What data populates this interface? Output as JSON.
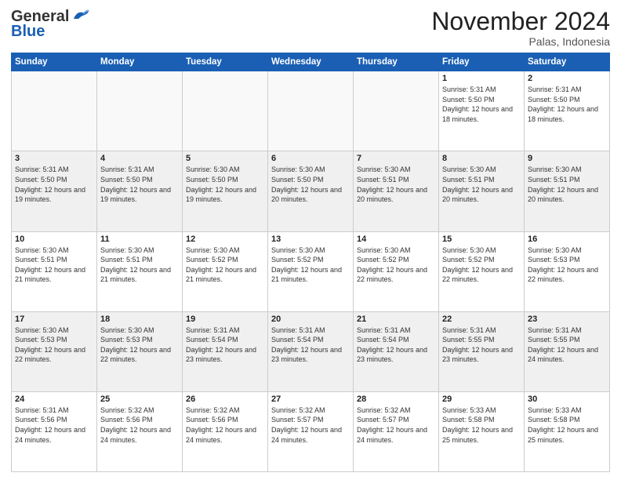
{
  "header": {
    "logo_general": "General",
    "logo_blue": "Blue",
    "month": "November 2024",
    "location": "Palas, Indonesia"
  },
  "weekdays": [
    "Sunday",
    "Monday",
    "Tuesday",
    "Wednesday",
    "Thursday",
    "Friday",
    "Saturday"
  ],
  "weeks": [
    [
      {
        "day": "",
        "sunrise": "",
        "sunset": "",
        "daylight": ""
      },
      {
        "day": "",
        "sunrise": "",
        "sunset": "",
        "daylight": ""
      },
      {
        "day": "",
        "sunrise": "",
        "sunset": "",
        "daylight": ""
      },
      {
        "day": "",
        "sunrise": "",
        "sunset": "",
        "daylight": ""
      },
      {
        "day": "",
        "sunrise": "",
        "sunset": "",
        "daylight": ""
      },
      {
        "day": "1",
        "sunrise": "Sunrise: 5:31 AM",
        "sunset": "Sunset: 5:50 PM",
        "daylight": "Daylight: 12 hours and 18 minutes."
      },
      {
        "day": "2",
        "sunrise": "Sunrise: 5:31 AM",
        "sunset": "Sunset: 5:50 PM",
        "daylight": "Daylight: 12 hours and 18 minutes."
      }
    ],
    [
      {
        "day": "3",
        "sunrise": "Sunrise: 5:31 AM",
        "sunset": "Sunset: 5:50 PM",
        "daylight": "Daylight: 12 hours and 19 minutes."
      },
      {
        "day": "4",
        "sunrise": "Sunrise: 5:31 AM",
        "sunset": "Sunset: 5:50 PM",
        "daylight": "Daylight: 12 hours and 19 minutes."
      },
      {
        "day": "5",
        "sunrise": "Sunrise: 5:30 AM",
        "sunset": "Sunset: 5:50 PM",
        "daylight": "Daylight: 12 hours and 19 minutes."
      },
      {
        "day": "6",
        "sunrise": "Sunrise: 5:30 AM",
        "sunset": "Sunset: 5:50 PM",
        "daylight": "Daylight: 12 hours and 20 minutes."
      },
      {
        "day": "7",
        "sunrise": "Sunrise: 5:30 AM",
        "sunset": "Sunset: 5:51 PM",
        "daylight": "Daylight: 12 hours and 20 minutes."
      },
      {
        "day": "8",
        "sunrise": "Sunrise: 5:30 AM",
        "sunset": "Sunset: 5:51 PM",
        "daylight": "Daylight: 12 hours and 20 minutes."
      },
      {
        "day": "9",
        "sunrise": "Sunrise: 5:30 AM",
        "sunset": "Sunset: 5:51 PM",
        "daylight": "Daylight: 12 hours and 20 minutes."
      }
    ],
    [
      {
        "day": "10",
        "sunrise": "Sunrise: 5:30 AM",
        "sunset": "Sunset: 5:51 PM",
        "daylight": "Daylight: 12 hours and 21 minutes."
      },
      {
        "day": "11",
        "sunrise": "Sunrise: 5:30 AM",
        "sunset": "Sunset: 5:51 PM",
        "daylight": "Daylight: 12 hours and 21 minutes."
      },
      {
        "day": "12",
        "sunrise": "Sunrise: 5:30 AM",
        "sunset": "Sunset: 5:52 PM",
        "daylight": "Daylight: 12 hours and 21 minutes."
      },
      {
        "day": "13",
        "sunrise": "Sunrise: 5:30 AM",
        "sunset": "Sunset: 5:52 PM",
        "daylight": "Daylight: 12 hours and 21 minutes."
      },
      {
        "day": "14",
        "sunrise": "Sunrise: 5:30 AM",
        "sunset": "Sunset: 5:52 PM",
        "daylight": "Daylight: 12 hours and 22 minutes."
      },
      {
        "day": "15",
        "sunrise": "Sunrise: 5:30 AM",
        "sunset": "Sunset: 5:52 PM",
        "daylight": "Daylight: 12 hours and 22 minutes."
      },
      {
        "day": "16",
        "sunrise": "Sunrise: 5:30 AM",
        "sunset": "Sunset: 5:53 PM",
        "daylight": "Daylight: 12 hours and 22 minutes."
      }
    ],
    [
      {
        "day": "17",
        "sunrise": "Sunrise: 5:30 AM",
        "sunset": "Sunset: 5:53 PM",
        "daylight": "Daylight: 12 hours and 22 minutes."
      },
      {
        "day": "18",
        "sunrise": "Sunrise: 5:30 AM",
        "sunset": "Sunset: 5:53 PM",
        "daylight": "Daylight: 12 hours and 22 minutes."
      },
      {
        "day": "19",
        "sunrise": "Sunrise: 5:31 AM",
        "sunset": "Sunset: 5:54 PM",
        "daylight": "Daylight: 12 hours and 23 minutes."
      },
      {
        "day": "20",
        "sunrise": "Sunrise: 5:31 AM",
        "sunset": "Sunset: 5:54 PM",
        "daylight": "Daylight: 12 hours and 23 minutes."
      },
      {
        "day": "21",
        "sunrise": "Sunrise: 5:31 AM",
        "sunset": "Sunset: 5:54 PM",
        "daylight": "Daylight: 12 hours and 23 minutes."
      },
      {
        "day": "22",
        "sunrise": "Sunrise: 5:31 AM",
        "sunset": "Sunset: 5:55 PM",
        "daylight": "Daylight: 12 hours and 23 minutes."
      },
      {
        "day": "23",
        "sunrise": "Sunrise: 5:31 AM",
        "sunset": "Sunset: 5:55 PM",
        "daylight": "Daylight: 12 hours and 24 minutes."
      }
    ],
    [
      {
        "day": "24",
        "sunrise": "Sunrise: 5:31 AM",
        "sunset": "Sunset: 5:56 PM",
        "daylight": "Daylight: 12 hours and 24 minutes."
      },
      {
        "day": "25",
        "sunrise": "Sunrise: 5:32 AM",
        "sunset": "Sunset: 5:56 PM",
        "daylight": "Daylight: 12 hours and 24 minutes."
      },
      {
        "day": "26",
        "sunrise": "Sunrise: 5:32 AM",
        "sunset": "Sunset: 5:56 PM",
        "daylight": "Daylight: 12 hours and 24 minutes."
      },
      {
        "day": "27",
        "sunrise": "Sunrise: 5:32 AM",
        "sunset": "Sunset: 5:57 PM",
        "daylight": "Daylight: 12 hours and 24 minutes."
      },
      {
        "day": "28",
        "sunrise": "Sunrise: 5:32 AM",
        "sunset": "Sunset: 5:57 PM",
        "daylight": "Daylight: 12 hours and 24 minutes."
      },
      {
        "day": "29",
        "sunrise": "Sunrise: 5:33 AM",
        "sunset": "Sunset: 5:58 PM",
        "daylight": "Daylight: 12 hours and 25 minutes."
      },
      {
        "day": "30",
        "sunrise": "Sunrise: 5:33 AM",
        "sunset": "Sunset: 5:58 PM",
        "daylight": "Daylight: 12 hours and 25 minutes."
      }
    ]
  ]
}
